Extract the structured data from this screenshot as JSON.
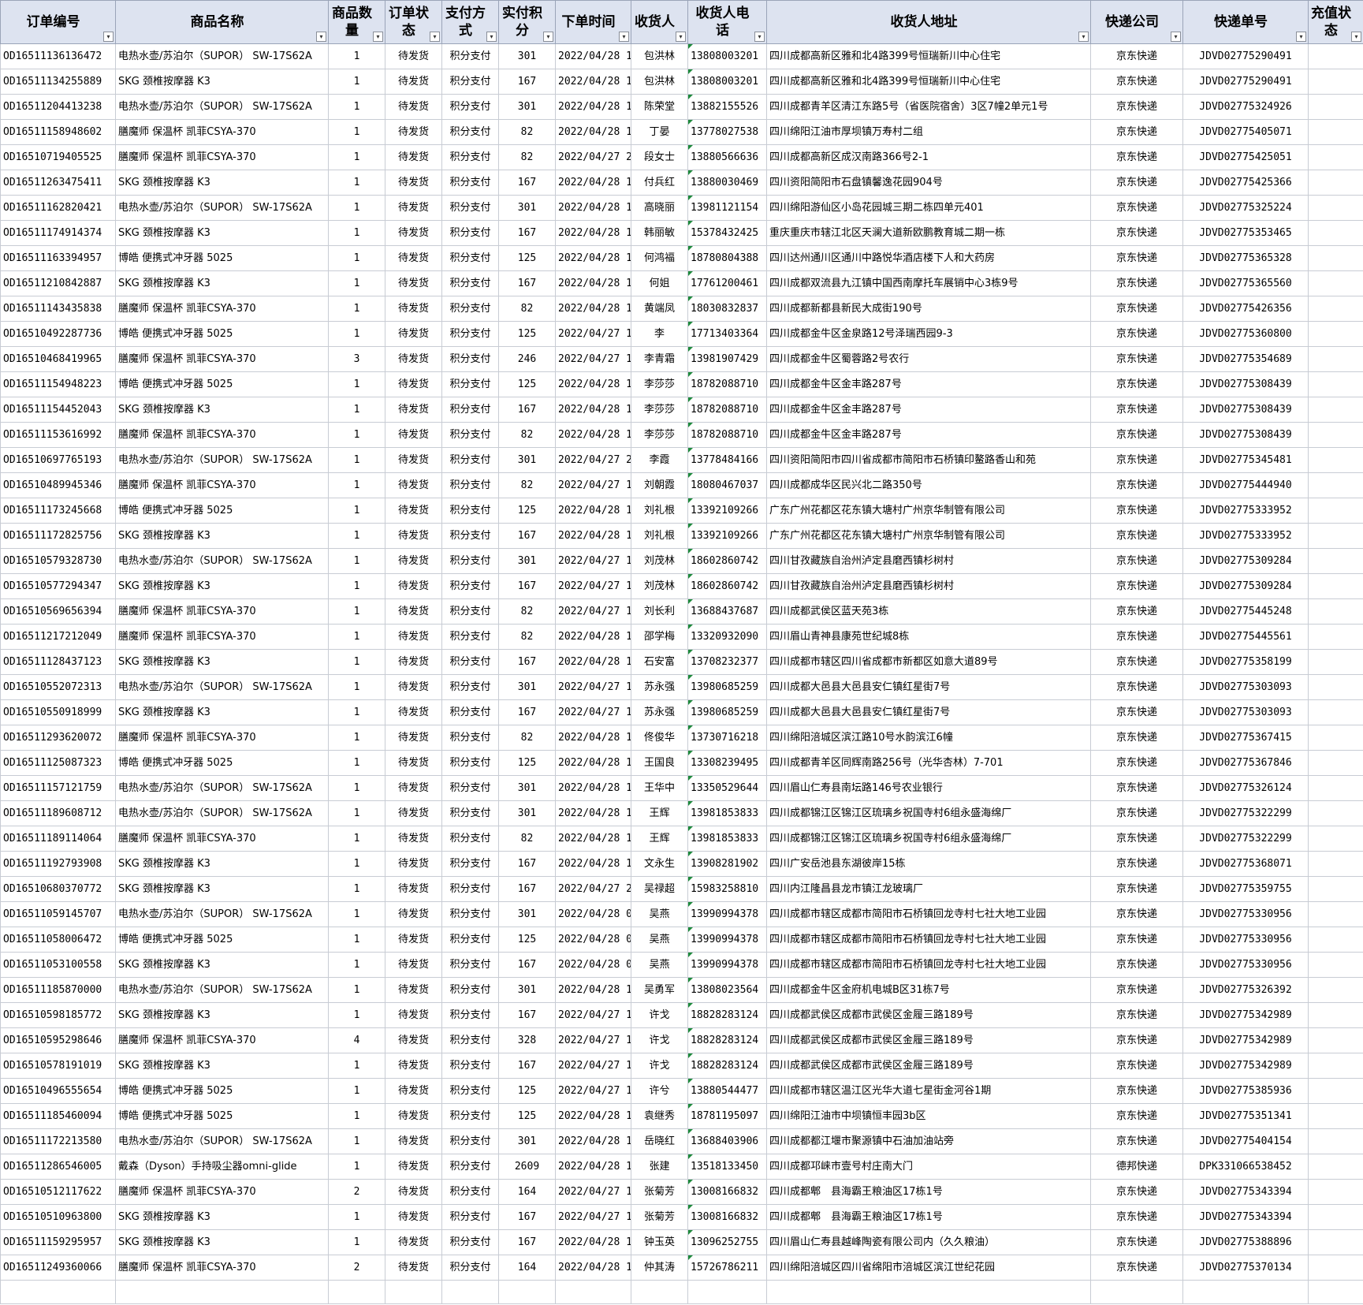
{
  "columns": [
    {
      "key": "order_id",
      "label": "订单编号"
    },
    {
      "key": "product",
      "label": "商品名称"
    },
    {
      "key": "qty",
      "label": "商品数量"
    },
    {
      "key": "status",
      "label": "订单状态"
    },
    {
      "key": "pay",
      "label": "支付方式"
    },
    {
      "key": "points",
      "label": "实付积分"
    },
    {
      "key": "time",
      "label": "下单时间"
    },
    {
      "key": "name",
      "label": "收货人"
    },
    {
      "key": "phone",
      "label": "收货人电话"
    },
    {
      "key": "addr",
      "label": "收货人地址"
    },
    {
      "key": "courier",
      "label": "快递公司"
    },
    {
      "key": "tracking",
      "label": "快递单号"
    },
    {
      "key": "recharge",
      "label": "充值状态"
    }
  ],
  "filter_glyph": "▾",
  "rows": [
    [
      "OD16511136136472",
      "电热水壶/苏泊尔（SUPOR） SW-17S62A",
      "1",
      "待发货",
      "积分支付",
      "301",
      "2022/04/28 1",
      "包洪林",
      "13808003201",
      "四川成都高新区雅和北4路399号恒瑞新川中心住宅",
      "京东快递",
      "JDVD02775290491",
      ""
    ],
    [
      "OD16511134255889",
      "SKG 颈椎按摩器 K3",
      "1",
      "待发货",
      "积分支付",
      "167",
      "2022/04/28 1",
      "包洪林",
      "13808003201",
      "四川成都高新区雅和北4路399号恒瑞新川中心住宅",
      "京东快递",
      "JDVD02775290491",
      ""
    ],
    [
      "OD16511204413238",
      "电热水壶/苏泊尔（SUPOR） SW-17S62A",
      "1",
      "待发货",
      "积分支付",
      "301",
      "2022/04/28 1",
      "陈荣堂",
      "13882155526",
      "四川成都青羊区清江东路5号（省医院宿舍）3区7幢2单元1号",
      "京东快递",
      "JDVD02775324926",
      ""
    ],
    [
      "OD16511158948602",
      "膳魔师 保温杯 凯菲CSYA-370",
      "1",
      "待发货",
      "积分支付",
      "82",
      "2022/04/28 1",
      "丁晏",
      "13778027538",
      "四川绵阳江油市厚坝镇万寿村二组",
      "京东快递",
      "JDVD02775405071",
      ""
    ],
    [
      "OD16510719405525",
      "膳魔师 保温杯 凯菲CSYA-370",
      "1",
      "待发货",
      "积分支付",
      "82",
      "2022/04/27 2",
      "段女士",
      "13880566636",
      "四川成都高新区成汉南路366号2-1",
      "京东快递",
      "JDVD02775425051",
      ""
    ],
    [
      "OD16511263475411",
      "SKG 颈椎按摩器 K3",
      "1",
      "待发货",
      "积分支付",
      "167",
      "2022/04/28 1",
      "付兵红",
      "13880030469",
      "四川资阳简阳市石盘镇馨逸花园904号",
      "京东快递",
      "JDVD02775425366",
      ""
    ],
    [
      "OD16511162820421",
      "电热水壶/苏泊尔（SUPOR） SW-17S62A",
      "1",
      "待发货",
      "积分支付",
      "301",
      "2022/04/28 1",
      "高晓丽",
      "13981121154",
      "四川绵阳游仙区小岛花园城三期二栋四单元401",
      "京东快递",
      "JDVD02775325224",
      ""
    ],
    [
      "OD16511174914374",
      "SKG 颈椎按摩器 K3",
      "1",
      "待发货",
      "积分支付",
      "167",
      "2022/04/28 1",
      "韩丽敏",
      "15378432425",
      "重庆重庆市辖江北区天澜大道新欧鹏教育城二期一栋",
      "京东快递",
      "JDVD02775353465",
      ""
    ],
    [
      "OD16511163394957",
      "博皓 便携式冲牙器 5025",
      "1",
      "待发货",
      "积分支付",
      "125",
      "2022/04/28 1",
      "何鸿福",
      "18780804388",
      "四川达州通川区通川中路悦华酒店楼下人和大药房",
      "京东快递",
      "JDVD02775365328",
      ""
    ],
    [
      "OD16511210842887",
      "SKG 颈椎按摩器 K3",
      "1",
      "待发货",
      "积分支付",
      "167",
      "2022/04/28 1",
      "何姐",
      "17761200461",
      "四川成都双流县九江镇中国西南摩托车展销中心3栋9号",
      "京东快递",
      "JDVD02775365560",
      ""
    ],
    [
      "OD16511143435838",
      "膳魔师 保温杯 凯菲CSYA-370",
      "1",
      "待发货",
      "积分支付",
      "82",
      "2022/04/28 1",
      "黄端凤",
      "18030832837",
      "四川成都新都县新民大成街190号",
      "京东快递",
      "JDVD02775426356",
      ""
    ],
    [
      "OD16510492287736",
      "博皓 便携式冲牙器 5025",
      "1",
      "待发货",
      "积分支付",
      "125",
      "2022/04/27 1",
      "李",
      "17713403364",
      "四川成都金牛区金泉路12号泽瑞西园9-3",
      "京东快递",
      "JDVD02775360800",
      ""
    ],
    [
      "OD16510468419965",
      "膳魔师 保温杯 凯菲CSYA-370",
      "3",
      "待发货",
      "积分支付",
      "246",
      "2022/04/27 1",
      "李青霜",
      "13981907429",
      "四川成都金牛区蜀蓉路2号农行",
      "京东快递",
      "JDVD02775354689",
      ""
    ],
    [
      "OD16511154948223",
      "博皓 便携式冲牙器 5025",
      "1",
      "待发货",
      "积分支付",
      "125",
      "2022/04/28 1",
      "李莎莎",
      "18782088710",
      "四川成都金牛区金丰路287号",
      "京东快递",
      "JDVD02775308439",
      ""
    ],
    [
      "OD16511154452043",
      "SKG 颈椎按摩器 K3",
      "1",
      "待发货",
      "积分支付",
      "167",
      "2022/04/28 1",
      "李莎莎",
      "18782088710",
      "四川成都金牛区金丰路287号",
      "京东快递",
      "JDVD02775308439",
      ""
    ],
    [
      "OD16511153616992",
      "膳魔师 保温杯 凯菲CSYA-370",
      "1",
      "待发货",
      "积分支付",
      "82",
      "2022/04/28 1",
      "李莎莎",
      "18782088710",
      "四川成都金牛区金丰路287号",
      "京东快递",
      "JDVD02775308439",
      ""
    ],
    [
      "OD16510697765193",
      "电热水壶/苏泊尔（SUPOR） SW-17S62A",
      "1",
      "待发货",
      "积分支付",
      "301",
      "2022/04/27 2",
      "李霞",
      "13778484166",
      "四川资阳简阳市四川省成都市简阳市石桥镇印鳌路香山和苑",
      "京东快递",
      "JDVD02775345481",
      ""
    ],
    [
      "OD16510489945346",
      "膳魔师 保温杯 凯菲CSYA-370",
      "1",
      "待发货",
      "积分支付",
      "82",
      "2022/04/27 1",
      "刘朝霞",
      "18080467037",
      "四川成都成华区民兴北二路350号",
      "京东快递",
      "JDVD02775444940",
      ""
    ],
    [
      "OD16511173245668",
      "博皓 便携式冲牙器 5025",
      "1",
      "待发货",
      "积分支付",
      "125",
      "2022/04/28 1",
      "刘礼根",
      "13392109266",
      "广东广州花都区花东镇大塘村广州京华制管有限公司",
      "京东快递",
      "JDVD02775333952",
      ""
    ],
    [
      "OD16511172825756",
      "SKG 颈椎按摩器 K3",
      "1",
      "待发货",
      "积分支付",
      "167",
      "2022/04/28 1",
      "刘礼根",
      "13392109266",
      "广东广州花都区花东镇大塘村广州京华制管有限公司",
      "京东快递",
      "JDVD02775333952",
      ""
    ],
    [
      "OD16510579328730",
      "电热水壶/苏泊尔（SUPOR） SW-17S62A",
      "1",
      "待发货",
      "积分支付",
      "301",
      "2022/04/27 1",
      "刘茂林",
      "18602860742",
      "四川甘孜藏族自治州泸定县磨西镇杉树村",
      "京东快递",
      "JDVD02775309284",
      ""
    ],
    [
      "OD16510577294347",
      "SKG 颈椎按摩器 K3",
      "1",
      "待发货",
      "积分支付",
      "167",
      "2022/04/27 1",
      "刘茂林",
      "18602860742",
      "四川甘孜藏族自治州泸定县磨西镇杉树村",
      "京东快递",
      "JDVD02775309284",
      ""
    ],
    [
      "OD16510569656394",
      "膳魔师 保温杯 凯菲CSYA-370",
      "1",
      "待发货",
      "积分支付",
      "82",
      "2022/04/27 1",
      "刘长利",
      "13688437687",
      "四川成都武侯区蓝天苑3栋",
      "京东快递",
      "JDVD02775445248",
      ""
    ],
    [
      "OD16511217212049",
      "膳魔师 保温杯 凯菲CSYA-370",
      "1",
      "待发货",
      "积分支付",
      "82",
      "2022/04/28 1",
      "邵学梅",
      "13320932090",
      "四川眉山青神县康苑世纪城8栋",
      "京东快递",
      "JDVD02775445561",
      ""
    ],
    [
      "OD16511128437123",
      "SKG 颈椎按摩器 K3",
      "1",
      "待发货",
      "积分支付",
      "167",
      "2022/04/28 1",
      "石安富",
      "13708232377",
      "四川成都市辖区四川省成都市新都区如意大道89号",
      "京东快递",
      "JDVD02775358199",
      ""
    ],
    [
      "OD16510552072313",
      "电热水壶/苏泊尔（SUPOR） SW-17S62A",
      "1",
      "待发货",
      "积分支付",
      "301",
      "2022/04/27 1",
      "苏永强",
      "13980685259",
      "四川成都大邑县大邑县安仁镇红星街7号",
      "京东快递",
      "JDVD02775303093",
      ""
    ],
    [
      "OD16510550918999",
      "SKG 颈椎按摩器 K3",
      "1",
      "待发货",
      "积分支付",
      "167",
      "2022/04/27 1",
      "苏永强",
      "13980685259",
      "四川成都大邑县大邑县安仁镇红星街7号",
      "京东快递",
      "JDVD02775303093",
      ""
    ],
    [
      "OD16511293620072",
      "膳魔师 保温杯 凯菲CSYA-370",
      "1",
      "待发货",
      "积分支付",
      "82",
      "2022/04/28 1",
      "佟俊华",
      "13730716218",
      "四川绵阳涪城区滨江路10号水韵滨江6幢",
      "京东快递",
      "JDVD02775367415",
      ""
    ],
    [
      "OD16511125087323",
      "博皓 便携式冲牙器 5025",
      "1",
      "待发货",
      "积分支付",
      "125",
      "2022/04/28 1",
      "王国良",
      "13308239495",
      "四川成都青羊区同辉南路256号（光华杏林）7-701",
      "京东快递",
      "JDVD02775367846",
      ""
    ],
    [
      "OD16511157121759",
      "电热水壶/苏泊尔（SUPOR） SW-17S62A",
      "1",
      "待发货",
      "积分支付",
      "301",
      "2022/04/28 1",
      "王华中",
      "13350529644",
      "四川眉山仁寿县南坛路146号农业银行",
      "京东快递",
      "JDVD02775326124",
      ""
    ],
    [
      "OD16511189608712",
      "电热水壶/苏泊尔（SUPOR） SW-17S62A",
      "1",
      "待发货",
      "积分支付",
      "301",
      "2022/04/28 1",
      "王辉",
      "13981853833",
      "四川成都锦江区锦江区琉璃乡祝国寺村6组永盛海绵厂",
      "京东快递",
      "JDVD02775322299",
      ""
    ],
    [
      "OD16511189114064",
      "膳魔师 保温杯 凯菲CSYA-370",
      "1",
      "待发货",
      "积分支付",
      "82",
      "2022/04/28 1",
      "王辉",
      "13981853833",
      "四川成都锦江区锦江区琉璃乡祝国寺村6组永盛海绵厂",
      "京东快递",
      "JDVD02775322299",
      ""
    ],
    [
      "OD16511192793908",
      "SKG 颈椎按摩器 K3",
      "1",
      "待发货",
      "积分支付",
      "167",
      "2022/04/28 1",
      "文永生",
      "13908281902",
      "四川广安岳池县东湖彼岸15栋",
      "京东快递",
      "JDVD02775368071",
      ""
    ],
    [
      "OD16510680370772",
      "SKG 颈椎按摩器 K3",
      "1",
      "待发货",
      "积分支付",
      "167",
      "2022/04/27 2",
      "吴禄超",
      "15983258810",
      "四川内江隆昌县龙市镇江龙玻璃厂",
      "京东快递",
      "JDVD02775359755",
      ""
    ],
    [
      "OD16511059145707",
      "电热水壶/苏泊尔（SUPOR） SW-17S62A",
      "1",
      "待发货",
      "积分支付",
      "301",
      "2022/04/28 0",
      "吴燕",
      "13990994378",
      "四川成都市辖区成都市简阳市石桥镇回龙寺村七社大地工业园",
      "京东快递",
      "JDVD02775330956",
      ""
    ],
    [
      "OD16511058006472",
      "博皓 便携式冲牙器 5025",
      "1",
      "待发货",
      "积分支付",
      "125",
      "2022/04/28 0",
      "吴燕",
      "13990994378",
      "四川成都市辖区成都市简阳市石桥镇回龙寺村七社大地工业园",
      "京东快递",
      "JDVD02775330956",
      ""
    ],
    [
      "OD16511053100558",
      "SKG 颈椎按摩器 K3",
      "1",
      "待发货",
      "积分支付",
      "167",
      "2022/04/28 0",
      "吴燕",
      "13990994378",
      "四川成都市辖区成都市简阳市石桥镇回龙寺村七社大地工业园",
      "京东快递",
      "JDVD02775330956",
      ""
    ],
    [
      "OD16511185870000",
      "电热水壶/苏泊尔（SUPOR） SW-17S62A",
      "1",
      "待发货",
      "积分支付",
      "301",
      "2022/04/28 1",
      "吴勇军",
      "13808023564",
      "四川成都金牛区金府机电城B区31栋7号",
      "京东快递",
      "JDVD02775326392",
      ""
    ],
    [
      "OD16510598185772",
      "SKG 颈椎按摩器 K3",
      "1",
      "待发货",
      "积分支付",
      "167",
      "2022/04/27 1",
      "许戈",
      "18828283124",
      "四川成都武侯区成都市武侯区金履三路189号",
      "京东快递",
      "JDVD02775342989",
      ""
    ],
    [
      "OD16510595298646",
      "膳魔师 保温杯 凯菲CSYA-370",
      "4",
      "待发货",
      "积分支付",
      "328",
      "2022/04/27 1",
      "许戈",
      "18828283124",
      "四川成都武侯区成都市武侯区金履三路189号",
      "京东快递",
      "JDVD02775342989",
      ""
    ],
    [
      "OD16510578191019",
      "SKG 颈椎按摩器 K3",
      "1",
      "待发货",
      "积分支付",
      "167",
      "2022/04/27 1",
      "许戈",
      "18828283124",
      "四川成都武侯区成都市武侯区金履三路189号",
      "京东快递",
      "JDVD02775342989",
      ""
    ],
    [
      "OD16510496555654",
      "博皓 便携式冲牙器 5025",
      "1",
      "待发货",
      "积分支付",
      "125",
      "2022/04/27 1",
      "许兮",
      "13880544477",
      "四川成都市辖区温江区光华大道七星街金河谷1期",
      "京东快递",
      "JDVD02775385936",
      ""
    ],
    [
      "OD16511185460094",
      "博皓 便携式冲牙器 5025",
      "1",
      "待发货",
      "积分支付",
      "125",
      "2022/04/28 1",
      "袁继秀",
      "18781195097",
      "四川绵阳江油市中坝镇恒丰园3b区",
      "京东快递",
      "JDVD02775351341",
      ""
    ],
    [
      "OD16511172213580",
      "电热水壶/苏泊尔（SUPOR） SW-17S62A",
      "1",
      "待发货",
      "积分支付",
      "301",
      "2022/04/28 1",
      "岳晓红",
      "13688403906",
      "四川成都都江堰市聚源镇中石油加油站旁",
      "京东快递",
      "JDVD02775404154",
      ""
    ],
    [
      "OD16511286546005",
      "戴森（Dyson）手持吸尘器omni-glide",
      "1",
      "待发货",
      "积分支付",
      "2609",
      "2022/04/28 1",
      "张建",
      "13518133450",
      "四川成都邛崃市壹号村庄南大门",
      "德邦快递",
      "DPK331066538452",
      ""
    ],
    [
      "OD16510512117622",
      "膳魔师 保温杯 凯菲CSYA-370",
      "2",
      "待发货",
      "积分支付",
      "164",
      "2022/04/27 1",
      "张菊芳",
      "13008166832",
      "四川成都郫　县海霸王粮油区17栋1号",
      "京东快递",
      "JDVD02775343394",
      ""
    ],
    [
      "OD16510510963800",
      "SKG 颈椎按摩器 K3",
      "1",
      "待发货",
      "积分支付",
      "167",
      "2022/04/27 1",
      "张菊芳",
      "13008166832",
      "四川成都郫　县海霸王粮油区17栋1号",
      "京东快递",
      "JDVD02775343394",
      ""
    ],
    [
      "OD16511159295957",
      "SKG 颈椎按摩器 K3",
      "1",
      "待发货",
      "积分支付",
      "167",
      "2022/04/28 1",
      "钟玉英",
      "13096252755",
      "四川眉山仁寿县越峰陶瓷有限公司内（久久粮油）",
      "京东快递",
      "JDVD02775388896",
      ""
    ],
    [
      "OD16511249360066",
      "膳魔师 保温杯 凯菲CSYA-370",
      "2",
      "待发货",
      "积分支付",
      "164",
      "2022/04/28 1",
      "仲其涛",
      "15726786211",
      "四川绵阳涪城区四川省绵阳市涪城区滨江世纪花园",
      "京东快递",
      "JDVD02775370134",
      ""
    ]
  ]
}
